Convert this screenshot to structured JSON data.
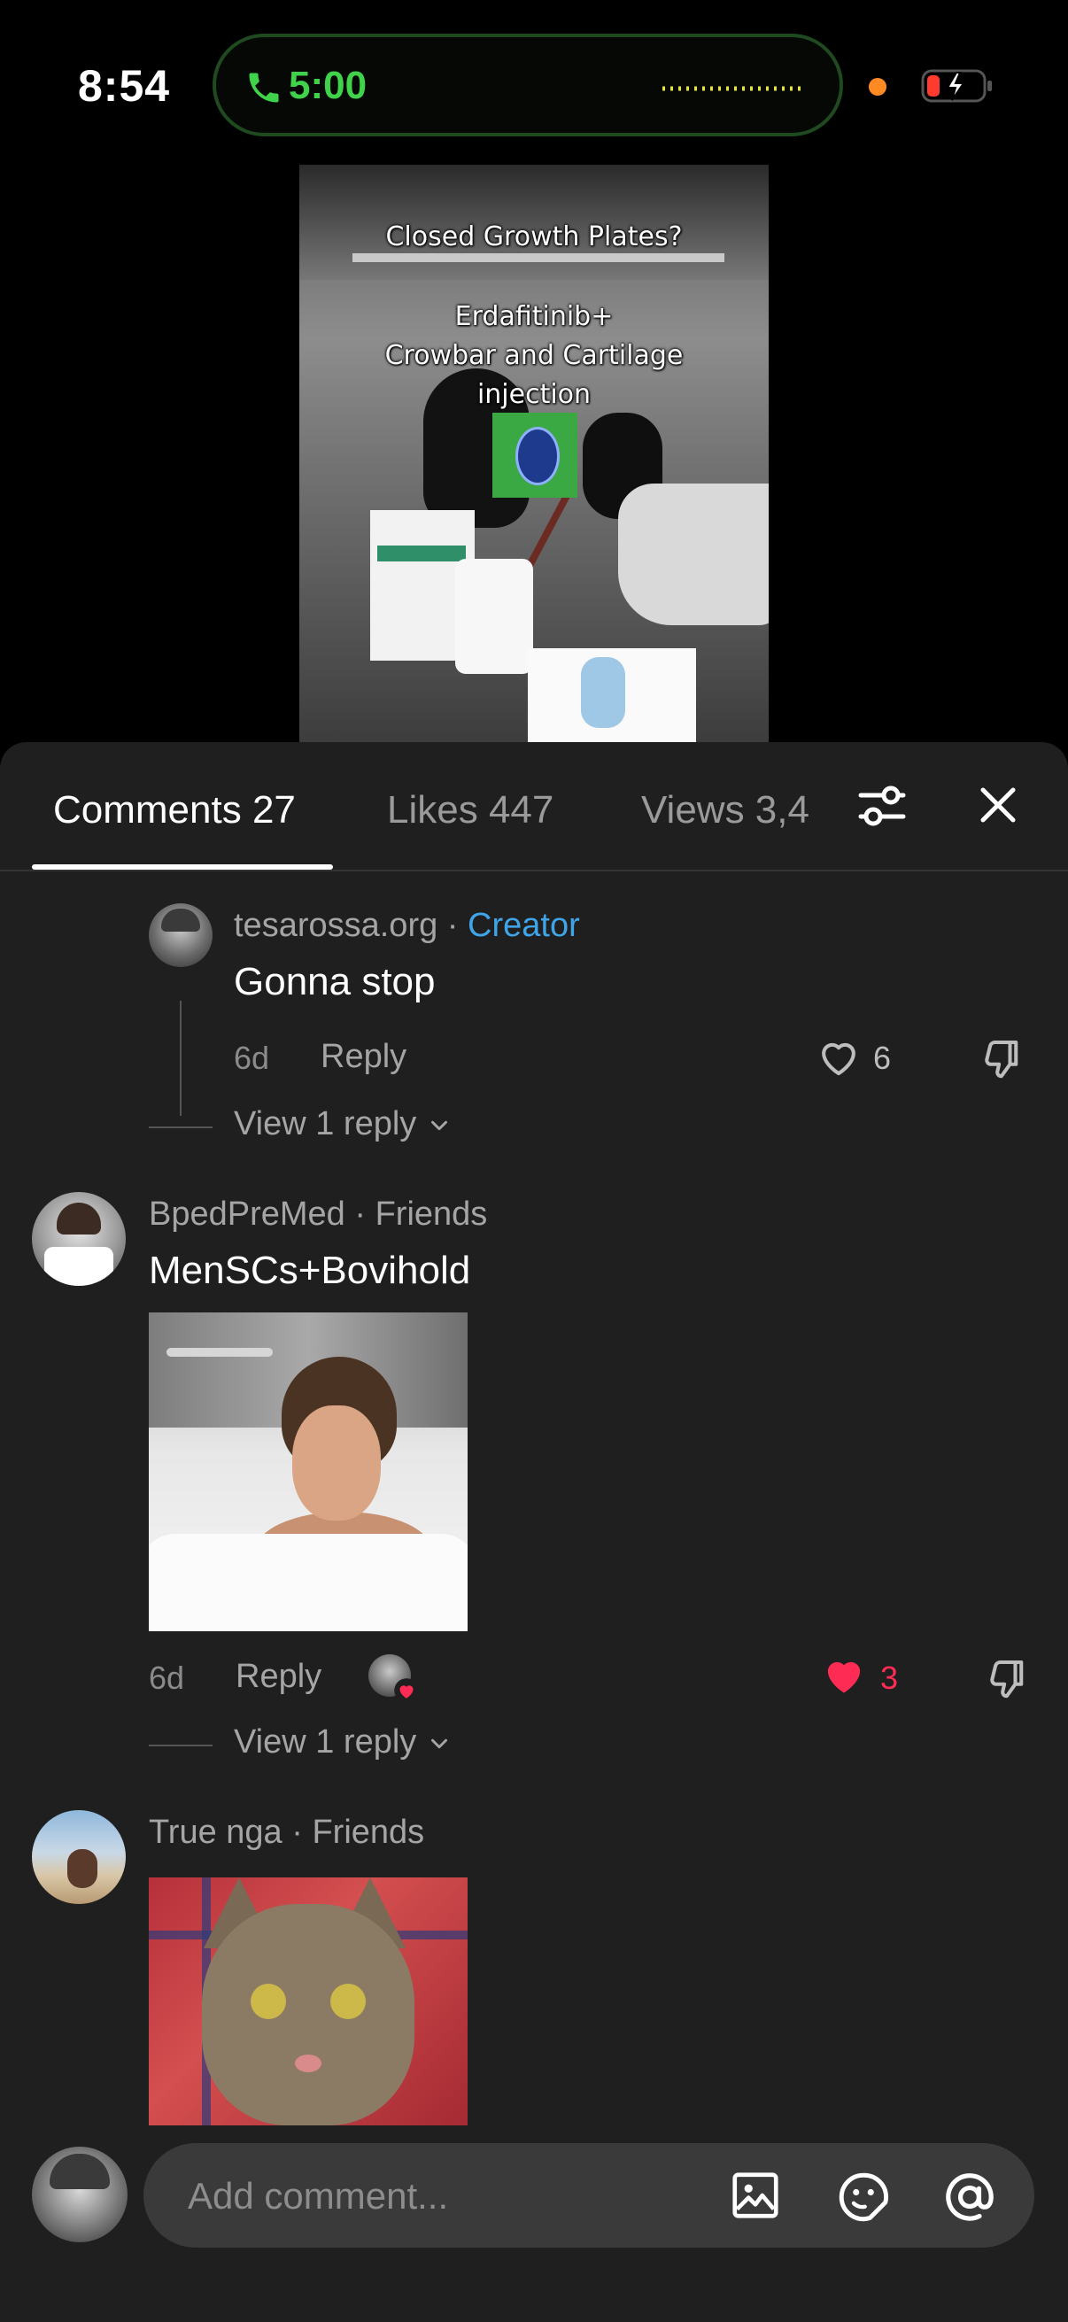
{
  "status_bar": {
    "time": "8:54",
    "call_duration": "5:00",
    "accent_color": "#3fd24a"
  },
  "video": {
    "caption_line1": "Closed Growth Plates?",
    "caption_line2": "Erdafitinib+",
    "caption_line3": "Crowbar and Cartilage",
    "caption_line4": "injection"
  },
  "sheet": {
    "tabs": [
      {
        "label": "Comments 27",
        "active": true
      },
      {
        "label": "Likes 447",
        "active": false
      },
      {
        "label": "Views 3,4",
        "active": false
      }
    ],
    "filter_icon": "sliders-icon",
    "close_icon": "close-icon"
  },
  "comments": [
    {
      "username": "tesarossa.org",
      "separator": "·",
      "badge": "Creator",
      "text": "Gonna stop",
      "age": "6d",
      "reply_label": "Reply",
      "likes": "6",
      "liked": false,
      "view_replies": "View 1 reply"
    },
    {
      "username": "BpedPreMed",
      "separator": "·",
      "badge": "Friends",
      "text": "MenSCs+Bovihold",
      "age": "6d",
      "reply_label": "Reply",
      "likes": "3",
      "liked": true,
      "view_replies": "View 1 reply"
    },
    {
      "username": "True nga",
      "separator": "·",
      "badge": "Friends"
    }
  ],
  "composer": {
    "placeholder": "Add comment..."
  },
  "colors": {
    "sheet_bg": "#1f1f1f",
    "creator_badge": "#3fa4e8",
    "like_red": "#fe2c55"
  }
}
